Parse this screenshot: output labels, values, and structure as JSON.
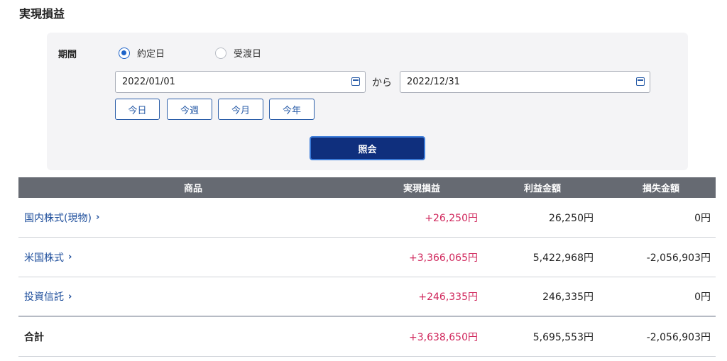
{
  "page": {
    "title": "実現損益"
  },
  "filter": {
    "period_label": "期間",
    "radio_trade_date": {
      "label": "約定日",
      "checked": true
    },
    "radio_settlement_date": {
      "label": "受渡日",
      "checked": false
    },
    "date_from": "2022/01/01",
    "date_to": "2022/12/31",
    "separator": "から",
    "quick_buttons": [
      "今日",
      "今週",
      "今月",
      "今年"
    ],
    "search_button": "照会"
  },
  "table": {
    "headers": {
      "product": "商品",
      "realized": "実現損益",
      "profit": "利益金額",
      "loss": "損失金額"
    },
    "rows": [
      {
        "product": "国内株式(現物)",
        "realized": "+26,250円",
        "profit": "26,250円",
        "loss": "0円"
      },
      {
        "product": "米国株式",
        "realized": "+3,366,065円",
        "profit": "5,422,968円",
        "loss": "-2,056,903円"
      },
      {
        "product": "投資信託",
        "realized": "+246,335円",
        "profit": "246,335円",
        "loss": "0円"
      }
    ],
    "total": {
      "label": "合計",
      "realized": "+3,638,650円",
      "profit": "5,695,553円",
      "loss": "-2,056,903円"
    }
  },
  "icons": {
    "chevron": "chevron-right-icon",
    "calendar": "calendar-icon"
  },
  "colors": {
    "accent": "#1f64c8",
    "primary_button": "#0f2f7d",
    "positive": "#d0275c",
    "header_bg": "#666a72"
  }
}
